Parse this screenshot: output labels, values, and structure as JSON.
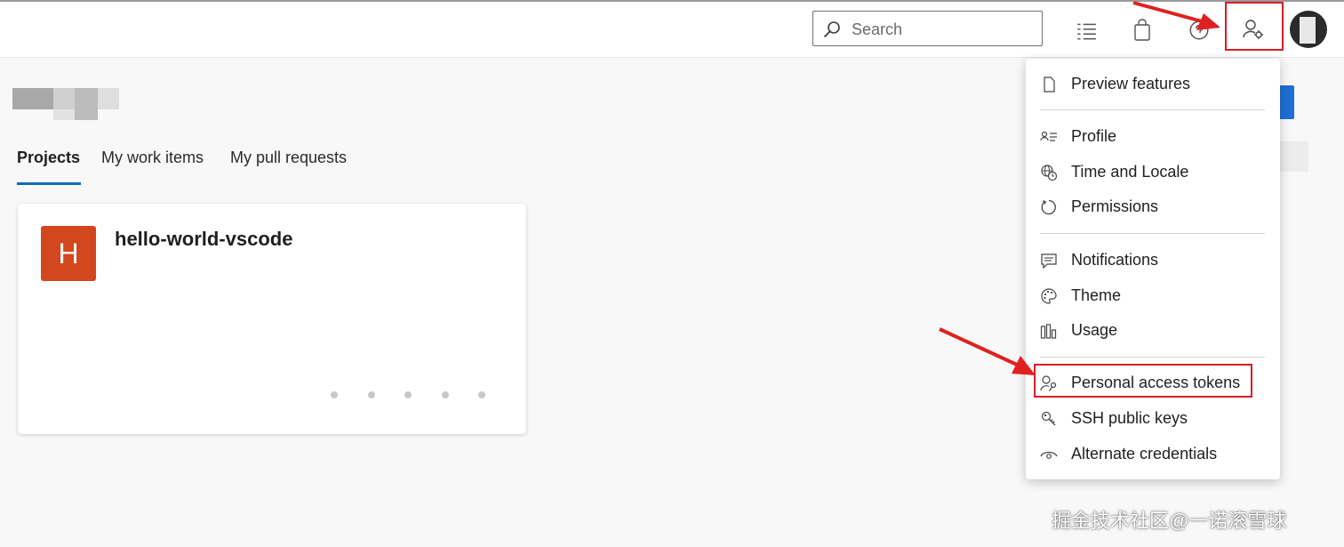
{
  "header": {
    "search_placeholder": "Search",
    "icons": [
      "work-items-icon",
      "marketplace-bag-icon",
      "help-icon",
      "user-settings-icon",
      "avatar"
    ]
  },
  "tabs": [
    {
      "label": "Projects",
      "active": true
    },
    {
      "label": "My work items",
      "active": false
    },
    {
      "label": "My pull requests",
      "active": false
    }
  ],
  "project_card": {
    "initial": "H",
    "name": "hello-world-vscode",
    "avatar_color": "#d2471e"
  },
  "user_menu": {
    "items": [
      {
        "label": "Preview features",
        "icon": "document-icon"
      },
      {
        "label": "Profile",
        "icon": "contact-card-icon"
      },
      {
        "label": "Time and Locale",
        "icon": "globe-clock-icon"
      },
      {
        "label": "Permissions",
        "icon": "refresh-circle-icon"
      },
      {
        "label": "Notifications",
        "icon": "chat-bubble-icon"
      },
      {
        "label": "Theme",
        "icon": "palette-icon"
      },
      {
        "label": "Usage",
        "icon": "bar-chart-icon"
      },
      {
        "label": "Personal access tokens",
        "icon": "key-person-icon"
      },
      {
        "label": "SSH public keys",
        "icon": "ssh-key-icon"
      },
      {
        "label": "Alternate credentials",
        "icon": "eye-icon"
      }
    ]
  },
  "colors": {
    "accent": "#0f6cbd",
    "highlight": "#d81e26"
  },
  "watermark": "掘金技术社区@一诺滚雪球"
}
